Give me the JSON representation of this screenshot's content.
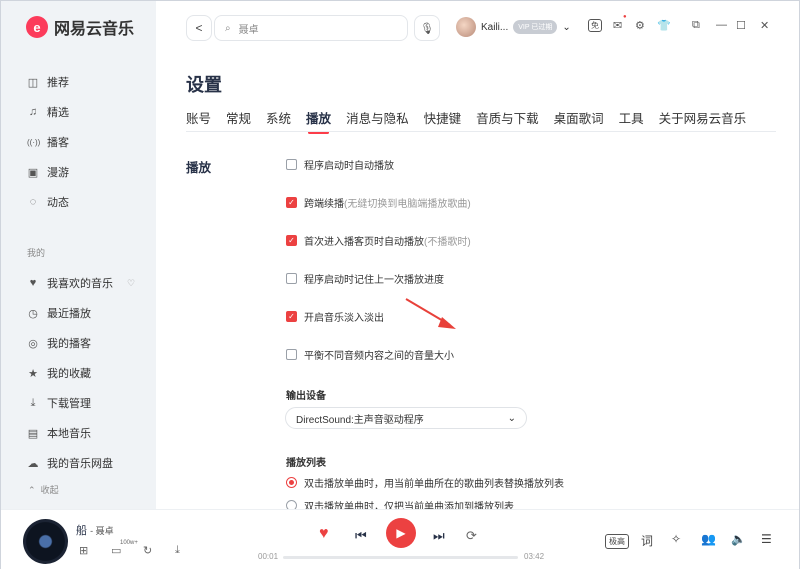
{
  "app": {
    "name": "网易云音乐",
    "logo_glyph": "e"
  },
  "sidebar": {
    "nav": [
      {
        "label": "推荐",
        "icon": "home-icon",
        "glyph": "◫"
      },
      {
        "label": "精选",
        "icon": "music-note-icon",
        "glyph": "♫"
      },
      {
        "label": "播客",
        "icon": "podcast-icon",
        "glyph": "((·))"
      },
      {
        "label": "漫游",
        "icon": "radio-icon",
        "glyph": "▣"
      },
      {
        "label": "动态",
        "icon": "chat-icon",
        "glyph": "◌"
      }
    ],
    "my_section": "我的",
    "my": [
      {
        "label": "我喜欢的音乐",
        "icon": "heart-icon",
        "glyph": "♥"
      },
      {
        "label": "最近播放",
        "icon": "clock-icon",
        "glyph": "◷"
      },
      {
        "label": "我的播客",
        "icon": "podcast-icon",
        "glyph": "◎"
      },
      {
        "label": "我的收藏",
        "icon": "star-icon",
        "glyph": "★"
      },
      {
        "label": "下载管理",
        "icon": "download-icon",
        "glyph": "⤓"
      },
      {
        "label": "本地音乐",
        "icon": "file-music-icon",
        "glyph": "▤"
      },
      {
        "label": "我的音乐网盘",
        "icon": "cloud-icon",
        "glyph": "☁"
      }
    ],
    "collapse_label": "收起"
  },
  "topbar": {
    "search_placeholder": "聂卓",
    "username": "Kaili...",
    "vip_text": "VIP 已过期"
  },
  "settings": {
    "title": "设置",
    "tabs": [
      "账号",
      "常规",
      "系统",
      "播放",
      "消息与隐私",
      "快捷键",
      "音质与下载",
      "桌面歌词",
      "工具",
      "关于网易云音乐"
    ],
    "active_tab": "播放",
    "section": "播放",
    "options": [
      {
        "label": "程序启动时自动播放",
        "hint": "",
        "checked": false
      },
      {
        "label": "跨端续播",
        "hint": "(无缝切换到电脑端播放歌曲)",
        "checked": true
      },
      {
        "label": "首次进入播客页时自动播放",
        "hint": "(不播歌时)",
        "checked": true
      },
      {
        "label": "程序启动时记住上一次播放进度",
        "hint": "",
        "checked": false
      },
      {
        "label": "开启音乐淡入淡出",
        "hint": "",
        "checked": true
      },
      {
        "label": "平衡不同音频内容之间的音量大小",
        "hint": "",
        "checked": false
      }
    ],
    "output_label": "输出设备",
    "output_value": "DirectSound:主声音驱动程序",
    "playlist_label": "播放列表",
    "playlist_options": [
      {
        "label": "双击播放单曲时，用当前单曲所在的歌曲列表替换播放列表",
        "selected": true
      },
      {
        "label": "双击播放单曲时，仅把当前单曲添加到播放列表",
        "selected": false
      }
    ]
  },
  "player": {
    "song": "船",
    "artist": "聂卓",
    "count_badge": "100w+",
    "time_current": "00:01",
    "time_total": "03:42",
    "progress": 0.005,
    "quality_label": "极高",
    "lyrics_label": "词"
  },
  "colors": {
    "accent": "#ec4141",
    "sidebar_bg": "#f0f3f6"
  }
}
